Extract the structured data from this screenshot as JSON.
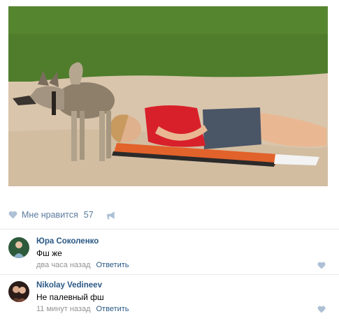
{
  "post": {
    "likes": {
      "label": "Мне нравится",
      "count": "57"
    }
  },
  "comments": [
    {
      "author": "Юра Соколенко",
      "text": "Фш же",
      "time": "два часа назад",
      "reply": "Ответить"
    },
    {
      "author": "Nikolay Vedineev",
      "text": "Не палевный фш",
      "time": "11 минут назад",
      "reply": "Ответить"
    }
  ],
  "colors": {
    "link": "#2a5885",
    "muted": "#939393",
    "icon": "#adc0d5"
  }
}
